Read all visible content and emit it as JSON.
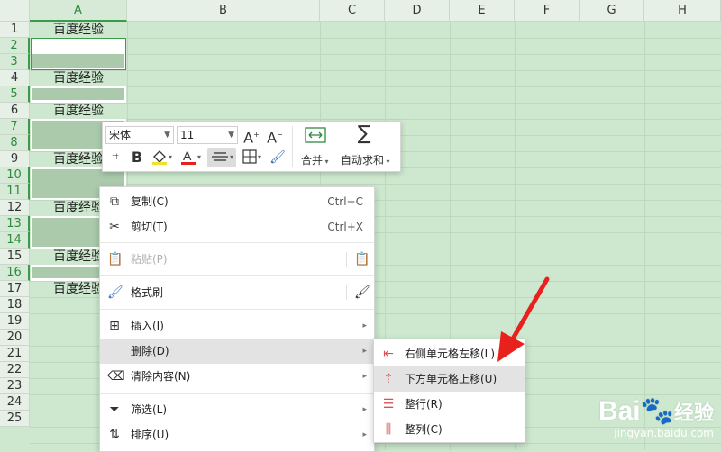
{
  "columns": [
    "A",
    "B",
    "C",
    "D",
    "E",
    "F",
    "G",
    "H"
  ],
  "rows": [
    "1",
    "2",
    "3",
    "4",
    "5",
    "6",
    "7",
    "8",
    "9",
    "10",
    "11",
    "12",
    "13",
    "14",
    "15",
    "16",
    "17",
    "18",
    "19",
    "20",
    "21",
    "22",
    "23",
    "24",
    "25"
  ],
  "cells": {
    "a1": "百度经验",
    "a4": "百度经验",
    "a6": "百度经验",
    "a9": "百度经验",
    "a12": "百度经验",
    "a15": "百度经验",
    "a17": "百度经验"
  },
  "toolbar": {
    "font_name": "宋体",
    "font_size": "11",
    "merge_label": "合并",
    "autosum_label": "自动求和"
  },
  "context_menu": {
    "copy": "复制(C)",
    "copy_shortcut": "Ctrl+C",
    "cut": "剪切(T)",
    "cut_shortcut": "Ctrl+X",
    "paste": "粘贴(P)",
    "format_painter": "格式刷",
    "insert": "插入(I)",
    "delete": "删除(D)",
    "clear": "清除内容(N)",
    "filter": "筛选(L)",
    "sort": "排序(U)"
  },
  "submenu": {
    "shift_left": "右侧单元格左移(L)",
    "shift_up": "下方单元格上移(U)",
    "entire_row": "整行(R)",
    "entire_col": "整列(C)"
  },
  "watermark": {
    "brand": "Bai",
    "brand_suffix": "经验",
    "url": "jingyan.baidu.com"
  },
  "colors": {
    "sheet_bg": "#cde8ce",
    "accent": "#3a9c49",
    "arrow": "#e8201e"
  }
}
